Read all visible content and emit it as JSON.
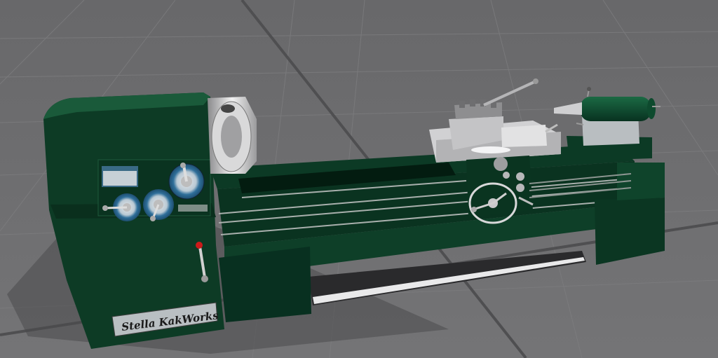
{
  "scene": {
    "type": "3D render of a lathe machine on a grid floor",
    "colors": {
      "floor": "#6b6b6d",
      "grid": "#7c7c7e",
      "machine_body": "#0d3a24",
      "machine_dark": "#072a19",
      "metal": "#c9c9cb",
      "dial": "#2f6f9a"
    }
  },
  "nameplate": {
    "text": "Stella KakWorks"
  },
  "icons": [
    "gear-dial-icon",
    "lever-icon",
    "handwheel-icon"
  ]
}
